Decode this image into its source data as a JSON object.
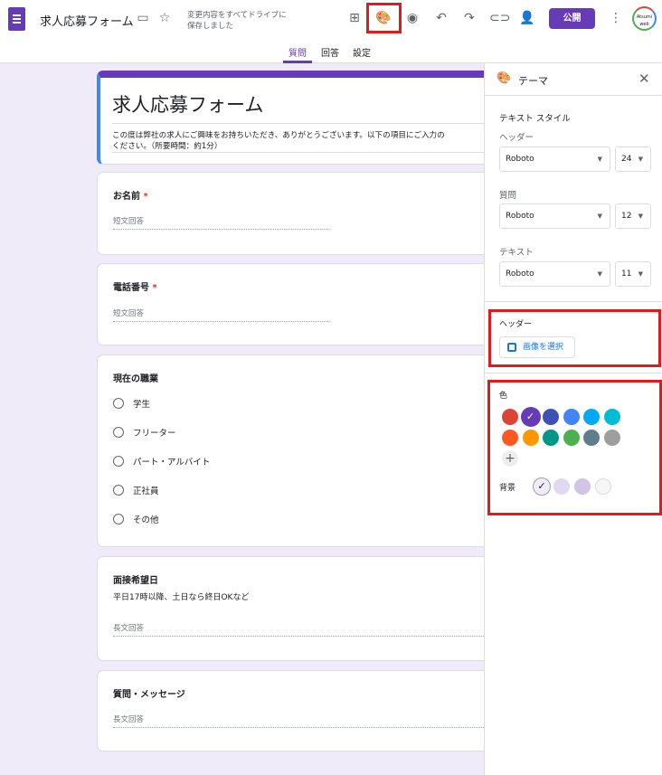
{
  "header": {
    "title": "求人応募フォーム",
    "save_status_line1": "変更内容をすべてドライブに",
    "save_status_line2": "保存しました",
    "publish": "公開",
    "avatar_logo": "Atsumi web"
  },
  "tabs": [
    {
      "label": "質問",
      "active": true
    },
    {
      "label": "回答"
    },
    {
      "label": "設定"
    }
  ],
  "form": {
    "title": "求人応募フォーム",
    "description_line1": "この度は弊社の求人にご興味をお持ちいただき、ありがとうございます。以下の項目にご入力の",
    "description_line2": "ください。（所要時間：約1分）",
    "questions": [
      {
        "title": "お名前",
        "required": "*",
        "placeholder": "短文回答"
      },
      {
        "title": "電話番号",
        "required": "*",
        "placeholder": "短文回答"
      },
      {
        "title": "現在の職業",
        "options": [
          "学生",
          "フリーター",
          "パート・アルバイト",
          "正社員",
          "その他"
        ]
      },
      {
        "title": "面接希望日",
        "description": "平日17時以降、土日なら終日OKなど",
        "placeholder": "長文回答"
      },
      {
        "title": "質問・メッセージ",
        "placeholder": "長文回答"
      }
    ]
  },
  "theme": {
    "title": "テーマ",
    "text_style": "テキスト スタイル",
    "styles": [
      {
        "label": "ヘッダー",
        "font": "Roboto",
        "size": "24"
      },
      {
        "label": "質問",
        "font": "Roboto",
        "size": "12"
      },
      {
        "label": "テキスト",
        "font": "Roboto",
        "size": "11"
      }
    ],
    "header_label": "ヘッダー",
    "select_image": "画像を選択",
    "color_label": "色",
    "bg_label": "背景",
    "colors": [
      "#db4437",
      "#673ab7",
      "#3f51b5",
      "#4285f4",
      "#03a9f4",
      "#00bcd4",
      "#ff5722",
      "#ff9800",
      "#009688",
      "#4caf50",
      "#607d8b",
      "#9e9e9e"
    ],
    "selected_color": "#673ab7",
    "backgrounds": [
      "#f0ebf8",
      "#e1d8f1",
      "#d1c4e9",
      "#f6f6f6"
    ],
    "selected_background": "#f0ebf8",
    "check": "✓",
    "add": "+"
  }
}
